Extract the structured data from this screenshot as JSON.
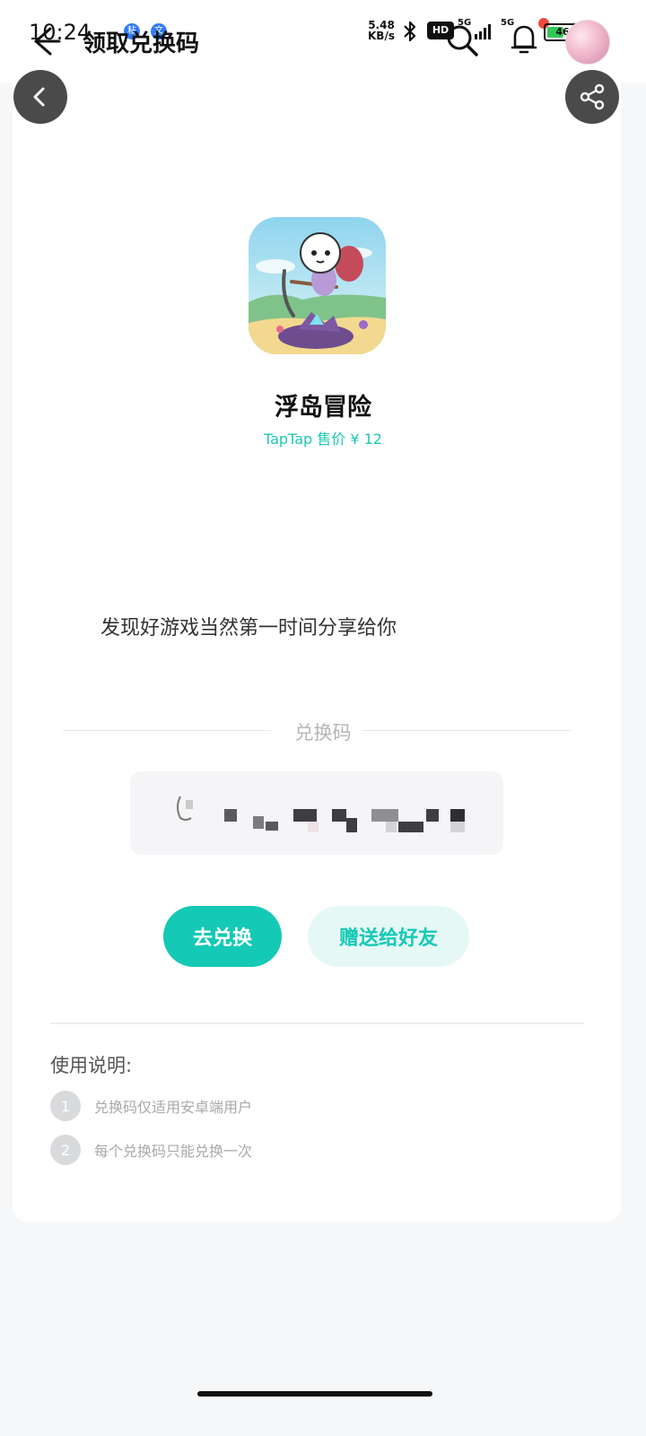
{
  "status_bar": {
    "time": "10:24",
    "badges": [
      "粘",
      "文"
    ],
    "net_speed_value": "5.48",
    "net_speed_unit": "KB/s",
    "hd_label": "HD",
    "signal1_label": "5G",
    "signal2_label": "5G",
    "battery_level": "46"
  },
  "app_bar": {
    "title": "领取兑换码",
    "back_icon": "arrow-left-icon",
    "search_icon": "search-icon",
    "bell_icon": "bell-icon"
  },
  "overlay_buttons": {
    "back_icon": "chevron-left-icon",
    "share_icon": "share-icon"
  },
  "game": {
    "name": "浮岛冒险",
    "price_text": "TapTap 售价 ¥ 12"
  },
  "share_message": "发现好游戏当然第一时间分享给你",
  "code_section": {
    "label": "兑换码",
    "code_masked": true
  },
  "actions": {
    "redeem_label": "去兑换",
    "gift_label": "赠送给好友"
  },
  "usage": {
    "title": "使用说明:",
    "items": [
      {
        "num": "1",
        "text": "兑换码仅适用安卓端用户"
      },
      {
        "num": "2",
        "text": "每个兑换码只能兑换一次"
      }
    ]
  },
  "colors": {
    "accent": "#14c9b5",
    "accent_light": "#e6f8f6",
    "price": "#1bc7b3"
  }
}
